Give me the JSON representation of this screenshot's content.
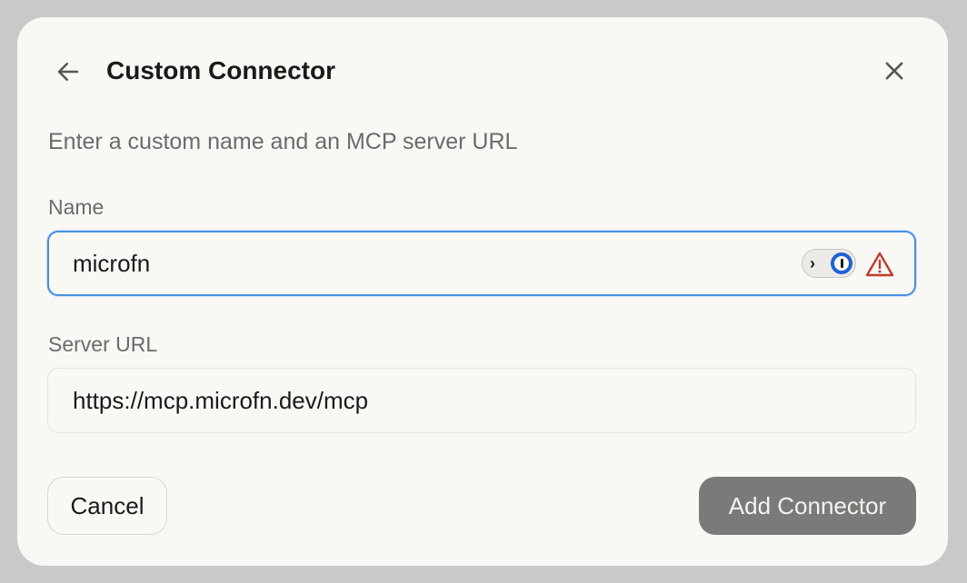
{
  "dialog": {
    "title": "Custom Connector",
    "subtitle": "Enter a custom name and an MCP server URL",
    "back_icon": "arrow-left-icon",
    "close_icon": "close-icon"
  },
  "fields": {
    "name": {
      "label": "Name",
      "value": "microfn",
      "password_manager_icon": "password-manager-toggle-icon",
      "warning_icon": "warning-triangle-icon"
    },
    "server_url": {
      "label": "Server URL",
      "value": "https://mcp.microfn.dev/mcp"
    }
  },
  "actions": {
    "cancel_label": "Cancel",
    "add_label": "Add Connector"
  },
  "colors": {
    "focus_border": "#4a8fdf",
    "warning": "#c0392b",
    "primary_disabled": "#7a7a78",
    "password_manager_blue": "#1f63d3"
  }
}
